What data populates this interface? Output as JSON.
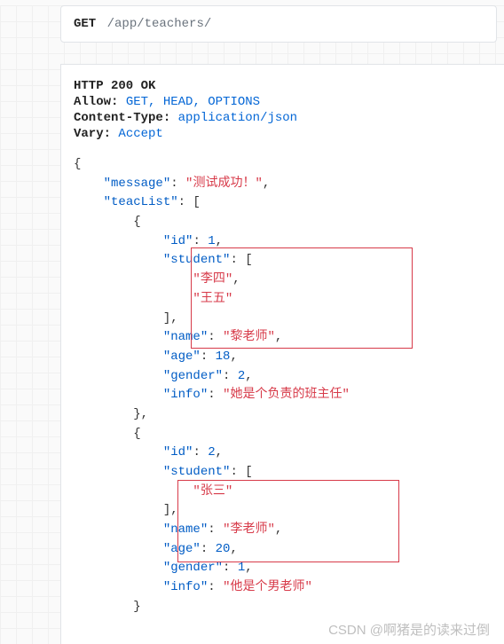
{
  "endpoint": {
    "method": "GET",
    "path": "/app/teachers/"
  },
  "response": {
    "status_line": "HTTP 200 OK",
    "headers": {
      "allow_label": "Allow:",
      "allow_value": "GET, HEAD, OPTIONS",
      "ctype_label": "Content-Type:",
      "ctype_value": "application/json",
      "vary_label": "Vary:",
      "vary_value": "Accept"
    }
  },
  "json_body": {
    "message_key": "\"message\"",
    "message_val": "\"测试成功！\"",
    "teacList_key": "\"teacList\"",
    "t1": {
      "id_key": "\"id\"",
      "id_val": "1",
      "student_key": "\"student\"",
      "s1": "\"李四\"",
      "s2": "\"王五\"",
      "name_key": "\"name\"",
      "name_val": "\"黎老师\"",
      "age_key": "\"age\"",
      "age_val": "18",
      "gender_key": "\"gender\"",
      "gender_val": "2",
      "info_key": "\"info\"",
      "info_val": "\"她是个负责的班主任\""
    },
    "t2": {
      "id_key": "\"id\"",
      "id_val": "2",
      "student_key": "\"student\"",
      "s1": "\"张三\"",
      "name_key": "\"name\"",
      "name_val": "\"李老师\"",
      "age_key": "\"age\"",
      "age_val": "20",
      "gender_key": "\"gender\"",
      "gender_val": "1",
      "info_key": "\"info\"",
      "info_val": "\"他是个男老师\""
    }
  },
  "watermark_left": "CSDN",
  "watermark_right": "@啊猪是的读来过倒"
}
